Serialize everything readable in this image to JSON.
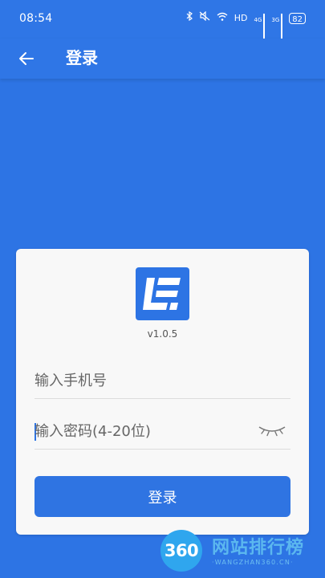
{
  "status_bar": {
    "time": "08:54",
    "network": "HD",
    "sim1": "4G",
    "sim2": "3G",
    "battery": "82",
    "icons": [
      "bluetooth-icon",
      "mute-icon",
      "wifi-icon",
      "signal-icon",
      "battery-icon"
    ]
  },
  "app_bar": {
    "title": "登录",
    "back_icon": "arrow-left-icon"
  },
  "login": {
    "version": "v1.0.5",
    "phone_placeholder": "输入手机号",
    "password_placeholder": "输入密码(4-20位)",
    "eye_icon": "closed-eye-icon",
    "submit_label": "登录"
  },
  "watermark": {
    "circle_text": "360",
    "title": "网站排行榜",
    "subtitle": "·WANGZHAN360.CN·"
  },
  "colors": {
    "primary": "#2d74e4",
    "card_background": "#f8f8f8",
    "watermark": "#5bb7ef"
  }
}
